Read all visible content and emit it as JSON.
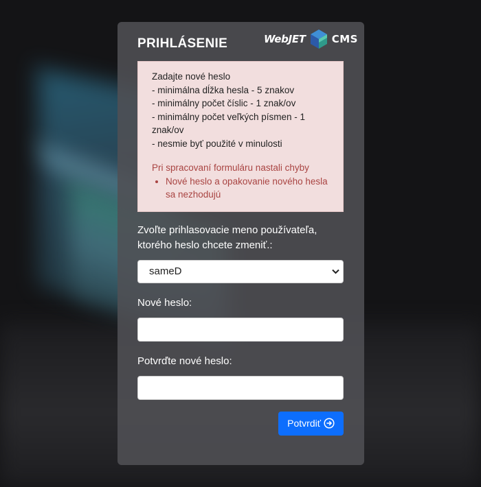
{
  "login": {
    "title": "PRIHLÁSENIE",
    "logo": {
      "brand_text": "WebJET",
      "product_text": "CMS",
      "icon": "webjet-cube-logo"
    }
  },
  "requirements": {
    "lines": [
      "Zadajte nové heslo",
      "- minimálna dĺžka hesla - 5 znakov",
      "- minimálny počet číslic - 1 znak/ov",
      "- minimálny počet veľkých písmen - 1 znak/ov",
      "- nesmie byť použité v minulosti"
    ]
  },
  "errors": {
    "heading": "Pri spracovaní formuláru nastali chyby",
    "items": [
      "Nové heslo a opakovanie nového hesla sa nezhodujú"
    ]
  },
  "form": {
    "user_label": "Zvoľte prihlasovacie meno používateľa, ktorého heslo chcete zmeniť.:",
    "user_selected": "sameD",
    "new_password_label": "Nové heslo:",
    "confirm_password_label": "Potvrďte nové heslo:",
    "submit_label": "Potvrdiť",
    "submit_icon": "arrow-right-circle-icon"
  },
  "colors": {
    "accent": "#0d6efd",
    "alert_bg": "#f2dede",
    "error_text": "#a94442",
    "card_bg": "#505054"
  }
}
